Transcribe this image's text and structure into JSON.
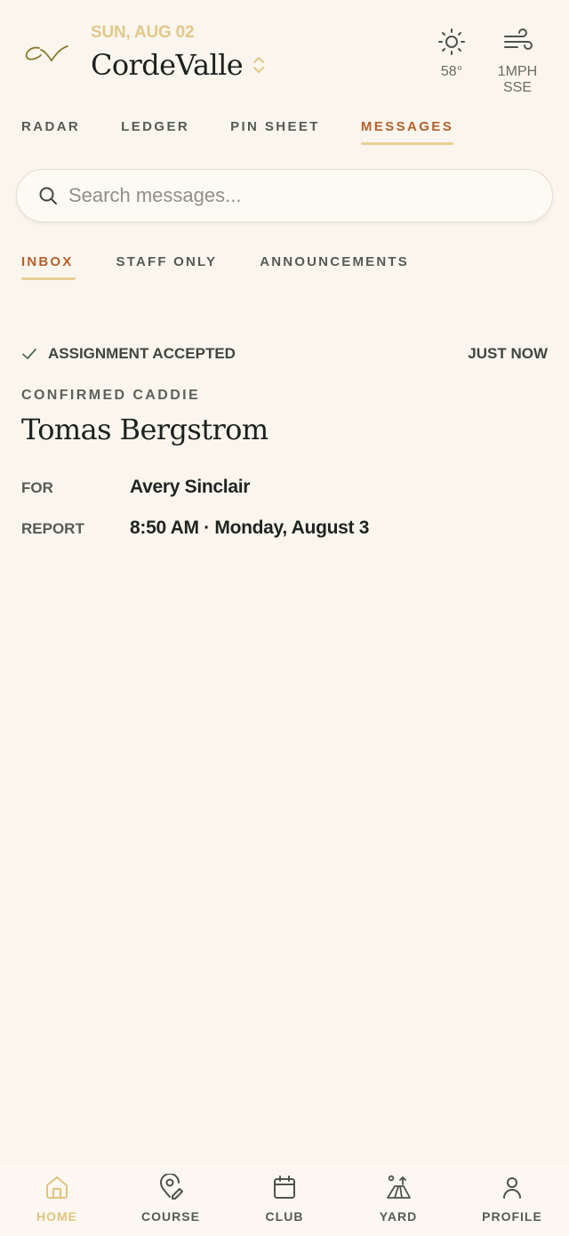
{
  "header": {
    "date": "SUN, AUG 02",
    "club_name": "CordeValle",
    "logo_icon": "cv-monogram-logo",
    "weather": {
      "temperature": "58°",
      "temperature_icon": "sun-icon",
      "wind": "1MPH SSE",
      "wind_icon": "wind-icon"
    }
  },
  "main_tabs": [
    {
      "label": "RADAR",
      "active": false
    },
    {
      "label": "LEDGER",
      "active": false
    },
    {
      "label": "PIN SHEET",
      "active": false
    },
    {
      "label": "MESSAGES",
      "active": true
    }
  ],
  "search": {
    "placeholder": "Search messages...",
    "value": ""
  },
  "sub_tabs": [
    {
      "label": "INBOX",
      "active": true
    },
    {
      "label": "STAFF ONLY",
      "active": false
    },
    {
      "label": "ANNOUNCEMENTS",
      "active": false
    }
  ],
  "message": {
    "status": "ASSIGNMENT ACCEPTED",
    "status_icon": "check-icon",
    "time": "JUST NOW",
    "caddie_label": "CONFIRMED CADDIE",
    "caddie_name": "Tomas Bergstrom",
    "for_label": "FOR",
    "for_value": "Avery Sinclair",
    "report_label": "REPORT",
    "report_value": "8:50 AM · Monday, August 3"
  },
  "bottom_nav": [
    {
      "label": "HOME",
      "icon": "home-icon",
      "active": true
    },
    {
      "label": "COURSE",
      "icon": "map-pin-edit-icon",
      "active": false
    },
    {
      "label": "CLUB",
      "icon": "calendar-icon",
      "active": false
    },
    {
      "label": "YARD",
      "icon": "driving-range-icon",
      "active": false
    },
    {
      "label": "PROFILE",
      "icon": "user-icon",
      "active": false
    }
  ],
  "colors": {
    "background": "#faf6ee",
    "accent": "#b5602a",
    "gold": "#e0c27f",
    "text": "#1f2420"
  }
}
